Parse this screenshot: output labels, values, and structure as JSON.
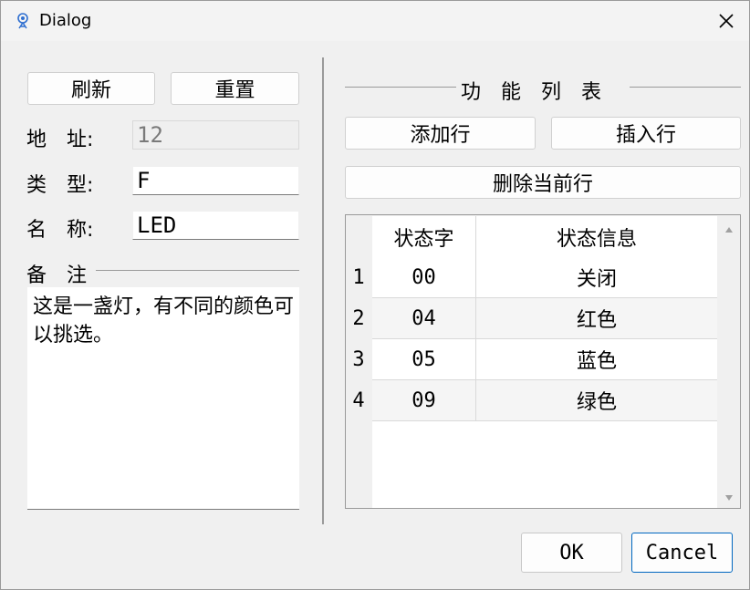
{
  "window": {
    "title": "Dialog"
  },
  "left": {
    "refresh_label": "刷新",
    "reset_label": "重置",
    "address_label": "地　址:",
    "address_value": "12",
    "type_label": "类　型:",
    "type_value": "F",
    "name_label": "名　称:",
    "name_value": "LED",
    "notes_label": "备　注",
    "notes_text": "这是一盏灯，有不同的颜色可以挑选。"
  },
  "right": {
    "section_title": "功　能　列　表",
    "add_row_label": "添加行",
    "insert_row_label": "插入行",
    "delete_row_label": "删除当前行",
    "table": {
      "headers": [
        "状态字",
        "状态信息"
      ],
      "rows": [
        {
          "num": "1",
          "code": "00",
          "info": "关闭"
        },
        {
          "num": "2",
          "code": "04",
          "info": "红色"
        },
        {
          "num": "3",
          "code": "05",
          "info": "蓝色"
        },
        {
          "num": "4",
          "code": "09",
          "info": "绿色"
        }
      ]
    }
  },
  "footer": {
    "ok_label": "OK",
    "cancel_label": "Cancel"
  },
  "colors": {
    "accent": "#0067c0",
    "window_bg": "#f0f0f0"
  }
}
